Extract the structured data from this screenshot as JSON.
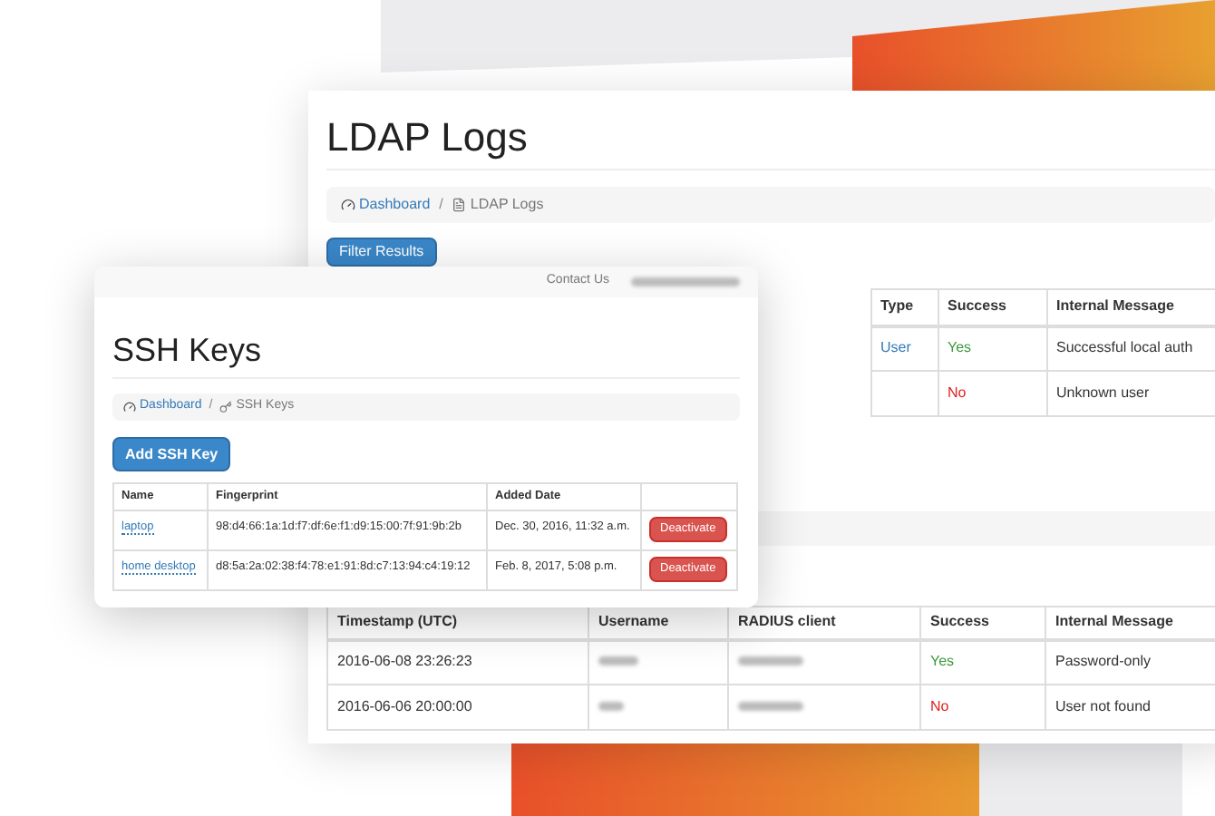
{
  "back_window": {
    "title": "LDAP Logs",
    "breadcrumb": [
      {
        "label": "Dashboard",
        "kind": "link"
      },
      {
        "label": "/",
        "kind": "separator"
      },
      {
        "label": "LDAP Logs",
        "kind": "current"
      }
    ],
    "filter_button": "Filter Results",
    "auth_table": {
      "columns": [
        "Type",
        "Success",
        "Internal Message"
      ],
      "rows": [
        {
          "type": "User",
          "success": "Yes",
          "ok": true,
          "message": "Successful local auth"
        },
        {
          "success": "No",
          "ok": false,
          "message": "Unknown user"
        }
      ]
    },
    "radius_table": {
      "columns": [
        "Timestamp (UTC)",
        "Username",
        "RADIUS client",
        "Success",
        "Internal Message"
      ],
      "rows": [
        {
          "timestamp": "2016-06-08 23:26:23",
          "success": "Yes",
          "ok": true,
          "message": "Password-only"
        },
        {
          "timestamp": "2016-06-06 20:00:00",
          "success": "No",
          "ok": false,
          "message": "User not found"
        }
      ]
    }
  },
  "front_window": {
    "top_link": "Contact Us",
    "title": "SSH Keys",
    "breadcrumb": [
      {
        "label": "Dashboard",
        "kind": "link"
      },
      {
        "label": "/",
        "kind": "separator"
      },
      {
        "label": "SSH Keys",
        "kind": "current"
      }
    ],
    "add_button": "Add SSH Key",
    "table": {
      "columns": [
        "Name",
        "Fingerprint",
        "Added Date"
      ],
      "rows": [
        {
          "name": "laptop",
          "fingerprint": "98:d4:66:1a:1d:f7:df:6e:f1:d9:15:00:7f:91:9b:2b",
          "added": "Dec. 30, 2016, 11:32 a.m.",
          "action": "Deactivate"
        },
        {
          "name": "home desktop",
          "fingerprint": "d8:5a:2a:02:38:f4:78:e1:91:8d:c7:13:94:c4:19:12",
          "added": "Feb. 8, 2017, 5:08 p.m.",
          "action": "Deactivate"
        }
      ]
    }
  }
}
